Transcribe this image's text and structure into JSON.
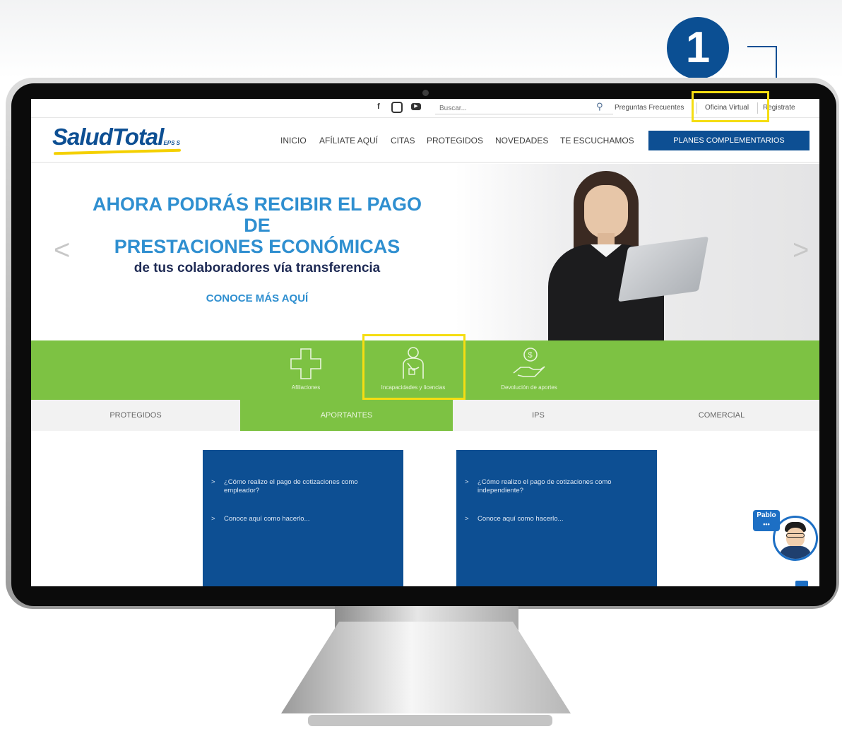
{
  "step": {
    "number": "1"
  },
  "topbar": {
    "social": {
      "facebook": "f"
    },
    "search": {
      "placeholder": "Buscar..."
    },
    "faq_link": "Preguntas Frecuentes",
    "oficina_virtual": "Oficina Virtual",
    "register_link": "Registrate"
  },
  "header": {
    "logo_text": "SaludTotal",
    "logo_suffix": "EPS S",
    "nav": [
      "INICIO",
      "AFÍLIATE AQUÍ",
      "CITAS",
      "PROTEGIDOS",
      "NOVEDADES",
      "TE ESCUCHAMOS"
    ],
    "cta": "PLANES COMPLEMENTARIOS"
  },
  "hero": {
    "title_line1": "AHORA PODRÁS RECIBIR EL PAGO",
    "title_line2": "DE",
    "title_line3": "PRESTACIONES ECONÓMICAS",
    "subtitle": "de tus colaboradores vía transferencia",
    "cta": "CONOCE MÁS AQUÍ",
    "prev_arrow": "<",
    "next_arrow": ">"
  },
  "services": {
    "afiliaciones": "Afiliaciones",
    "incapacidades": "Incapacidades y licencias",
    "devolucion": "Devolución de aportes"
  },
  "tabs": {
    "protegidos": "PROTEGIDOS",
    "aportantes": "APORTANTES",
    "ips": "IPS",
    "comercial": "COMERCIAL",
    "active": "APORTANTES"
  },
  "cards": {
    "empleador": {
      "question": "¿Cómo realizo el pago de cotizaciones como empleador?",
      "link": "Conoce aquí como hacerlo..."
    },
    "independiente": {
      "question": "¿Cómo realizo el pago de cotizaciones como independiente?",
      "link": "Conoce aquí como hacerlo..."
    }
  },
  "chat": {
    "name": "Pablo",
    "dots": "•••"
  },
  "colors": {
    "brand_blue": "#0d4f93",
    "accent_green": "#7dc243",
    "hero_blue": "#2f8fd0",
    "highlight_yellow": "#f5dd12"
  },
  "icons": {
    "facebook": "facebook-icon",
    "instagram": "instagram-icon",
    "youtube": "youtube-icon",
    "search": "search-icon",
    "afiliaciones": "cross-plus-icon",
    "incapacidades": "injured-person-icon",
    "devolucion": "hand-coin-icon",
    "mail": "mail-icon"
  }
}
